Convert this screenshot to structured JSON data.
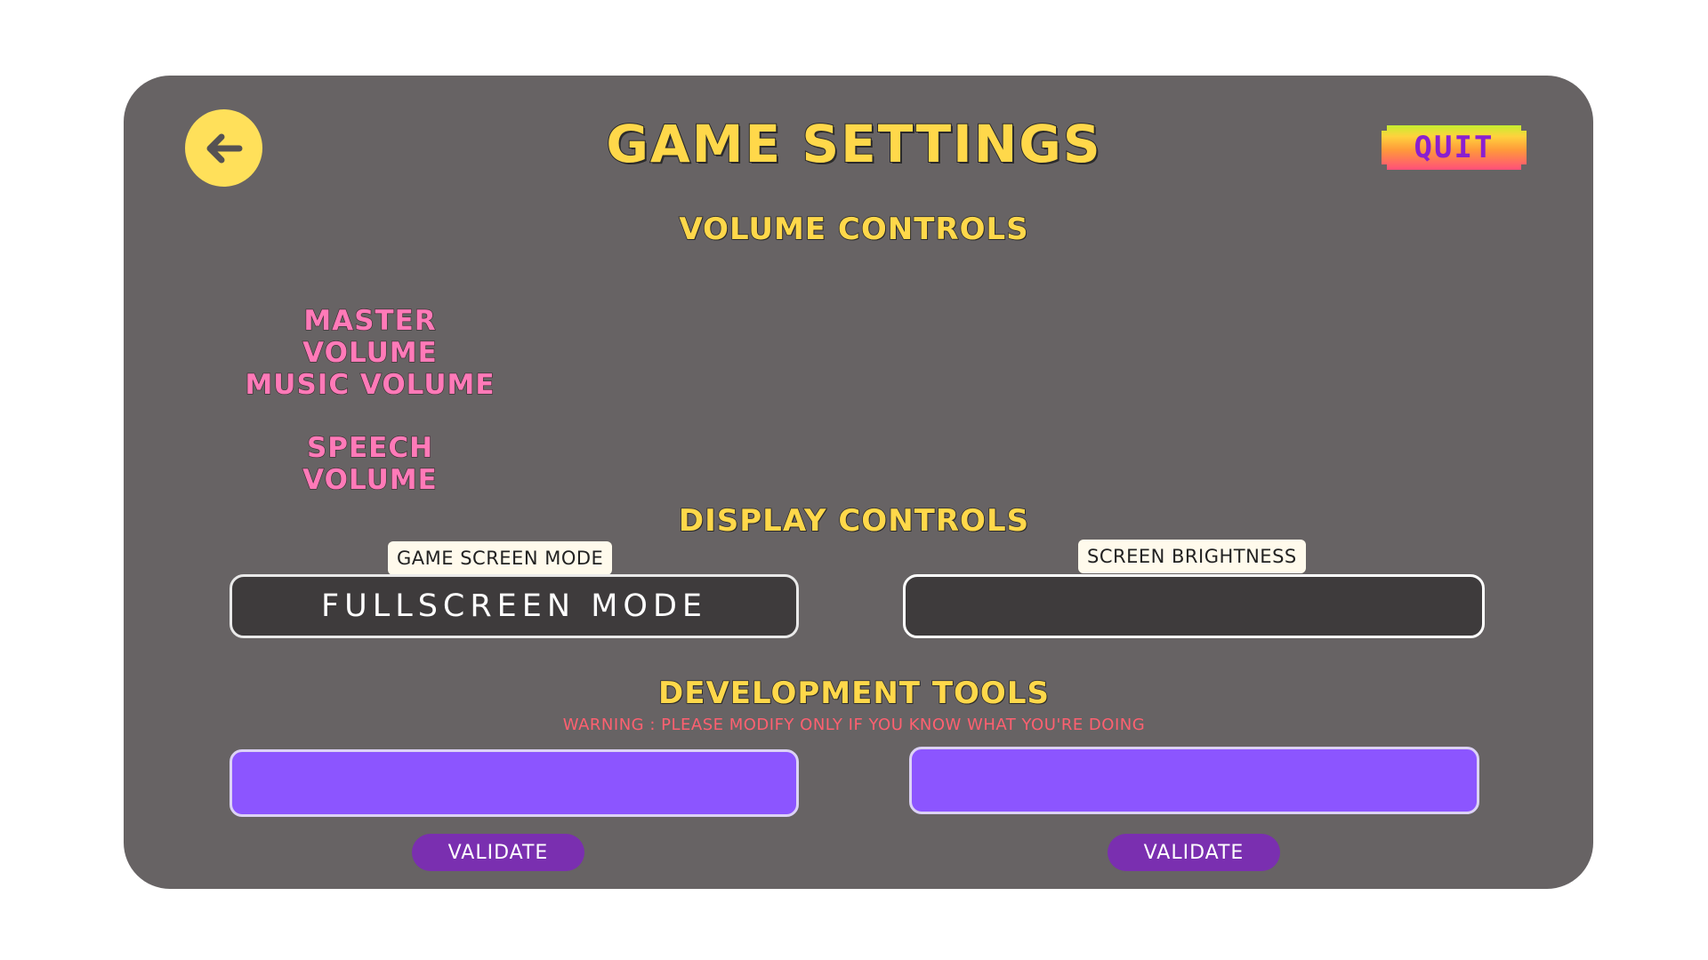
{
  "header": {
    "title": "GAME SETTINGS",
    "back_icon": "arrow-left-icon",
    "quit_label": "QUIT"
  },
  "volume": {
    "section_title": "VOLUME CONTROLS",
    "master_label": "MASTER VOLUME",
    "music_label": "MUSIC VOLUME",
    "speech_label": "SPEECH VOLUME"
  },
  "display": {
    "section_title": "DISPLAY CONTROLS",
    "screen_mode_label": "GAME SCREEN MODE",
    "screen_mode_value": "FULLSCREEN MODE",
    "brightness_label": "SCREEN BRIGHTNESS",
    "brightness_value": ""
  },
  "dev_tools": {
    "section_title": "DEVELOPMENT TOOLS",
    "warning": "WARNING : PLEASE MODIFY ONLY IF YOU KNOW WHAT YOU'RE DOING",
    "left_value": "",
    "right_value": "",
    "left_validate_label": "VALIDATE",
    "right_validate_label": "VALIDATE"
  },
  "colors": {
    "panel": "#676364",
    "title_yellow": "#ffd84a",
    "label_pink": "#ff7ab8",
    "warning_red": "#ff6070",
    "input_purple": "#8c55ff",
    "button_purple": "#7a2fb0"
  }
}
